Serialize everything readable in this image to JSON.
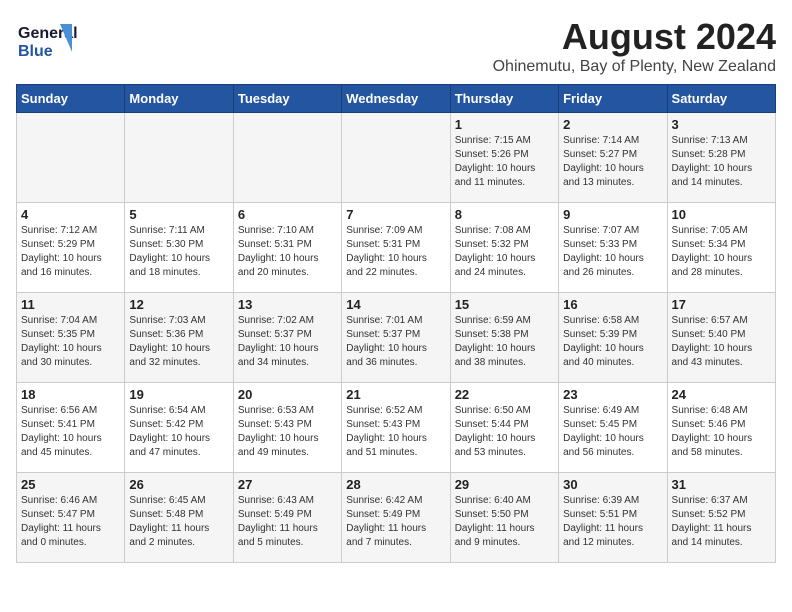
{
  "header": {
    "logo_line1": "General",
    "logo_line2": "Blue",
    "title": "August 2024",
    "subtitle": "Ohinemutu, Bay of Plenty, New Zealand"
  },
  "calendar": {
    "days_of_week": [
      "Sunday",
      "Monday",
      "Tuesday",
      "Wednesday",
      "Thursday",
      "Friday",
      "Saturday"
    ],
    "weeks": [
      [
        {
          "day": "",
          "info": ""
        },
        {
          "day": "",
          "info": ""
        },
        {
          "day": "",
          "info": ""
        },
        {
          "day": "",
          "info": ""
        },
        {
          "day": "1",
          "info": "Sunrise: 7:15 AM\nSunset: 5:26 PM\nDaylight: 10 hours\nand 11 minutes."
        },
        {
          "day": "2",
          "info": "Sunrise: 7:14 AM\nSunset: 5:27 PM\nDaylight: 10 hours\nand 13 minutes."
        },
        {
          "day": "3",
          "info": "Sunrise: 7:13 AM\nSunset: 5:28 PM\nDaylight: 10 hours\nand 14 minutes."
        }
      ],
      [
        {
          "day": "4",
          "info": "Sunrise: 7:12 AM\nSunset: 5:29 PM\nDaylight: 10 hours\nand 16 minutes."
        },
        {
          "day": "5",
          "info": "Sunrise: 7:11 AM\nSunset: 5:30 PM\nDaylight: 10 hours\nand 18 minutes."
        },
        {
          "day": "6",
          "info": "Sunrise: 7:10 AM\nSunset: 5:31 PM\nDaylight: 10 hours\nand 20 minutes."
        },
        {
          "day": "7",
          "info": "Sunrise: 7:09 AM\nSunset: 5:31 PM\nDaylight: 10 hours\nand 22 minutes."
        },
        {
          "day": "8",
          "info": "Sunrise: 7:08 AM\nSunset: 5:32 PM\nDaylight: 10 hours\nand 24 minutes."
        },
        {
          "day": "9",
          "info": "Sunrise: 7:07 AM\nSunset: 5:33 PM\nDaylight: 10 hours\nand 26 minutes."
        },
        {
          "day": "10",
          "info": "Sunrise: 7:05 AM\nSunset: 5:34 PM\nDaylight: 10 hours\nand 28 minutes."
        }
      ],
      [
        {
          "day": "11",
          "info": "Sunrise: 7:04 AM\nSunset: 5:35 PM\nDaylight: 10 hours\nand 30 minutes."
        },
        {
          "day": "12",
          "info": "Sunrise: 7:03 AM\nSunset: 5:36 PM\nDaylight: 10 hours\nand 32 minutes."
        },
        {
          "day": "13",
          "info": "Sunrise: 7:02 AM\nSunset: 5:37 PM\nDaylight: 10 hours\nand 34 minutes."
        },
        {
          "day": "14",
          "info": "Sunrise: 7:01 AM\nSunset: 5:37 PM\nDaylight: 10 hours\nand 36 minutes."
        },
        {
          "day": "15",
          "info": "Sunrise: 6:59 AM\nSunset: 5:38 PM\nDaylight: 10 hours\nand 38 minutes."
        },
        {
          "day": "16",
          "info": "Sunrise: 6:58 AM\nSunset: 5:39 PM\nDaylight: 10 hours\nand 40 minutes."
        },
        {
          "day": "17",
          "info": "Sunrise: 6:57 AM\nSunset: 5:40 PM\nDaylight: 10 hours\nand 43 minutes."
        }
      ],
      [
        {
          "day": "18",
          "info": "Sunrise: 6:56 AM\nSunset: 5:41 PM\nDaylight: 10 hours\nand 45 minutes."
        },
        {
          "day": "19",
          "info": "Sunrise: 6:54 AM\nSunset: 5:42 PM\nDaylight: 10 hours\nand 47 minutes."
        },
        {
          "day": "20",
          "info": "Sunrise: 6:53 AM\nSunset: 5:43 PM\nDaylight: 10 hours\nand 49 minutes."
        },
        {
          "day": "21",
          "info": "Sunrise: 6:52 AM\nSunset: 5:43 PM\nDaylight: 10 hours\nand 51 minutes."
        },
        {
          "day": "22",
          "info": "Sunrise: 6:50 AM\nSunset: 5:44 PM\nDaylight: 10 hours\nand 53 minutes."
        },
        {
          "day": "23",
          "info": "Sunrise: 6:49 AM\nSunset: 5:45 PM\nDaylight: 10 hours\nand 56 minutes."
        },
        {
          "day": "24",
          "info": "Sunrise: 6:48 AM\nSunset: 5:46 PM\nDaylight: 10 hours\nand 58 minutes."
        }
      ],
      [
        {
          "day": "25",
          "info": "Sunrise: 6:46 AM\nSunset: 5:47 PM\nDaylight: 11 hours\nand 0 minutes."
        },
        {
          "day": "26",
          "info": "Sunrise: 6:45 AM\nSunset: 5:48 PM\nDaylight: 11 hours\nand 2 minutes."
        },
        {
          "day": "27",
          "info": "Sunrise: 6:43 AM\nSunset: 5:49 PM\nDaylight: 11 hours\nand 5 minutes."
        },
        {
          "day": "28",
          "info": "Sunrise: 6:42 AM\nSunset: 5:49 PM\nDaylight: 11 hours\nand 7 minutes."
        },
        {
          "day": "29",
          "info": "Sunrise: 6:40 AM\nSunset: 5:50 PM\nDaylight: 11 hours\nand 9 minutes."
        },
        {
          "day": "30",
          "info": "Sunrise: 6:39 AM\nSunset: 5:51 PM\nDaylight: 11 hours\nand 12 minutes."
        },
        {
          "day": "31",
          "info": "Sunrise: 6:37 AM\nSunset: 5:52 PM\nDaylight: 11 hours\nand 14 minutes."
        }
      ]
    ]
  }
}
